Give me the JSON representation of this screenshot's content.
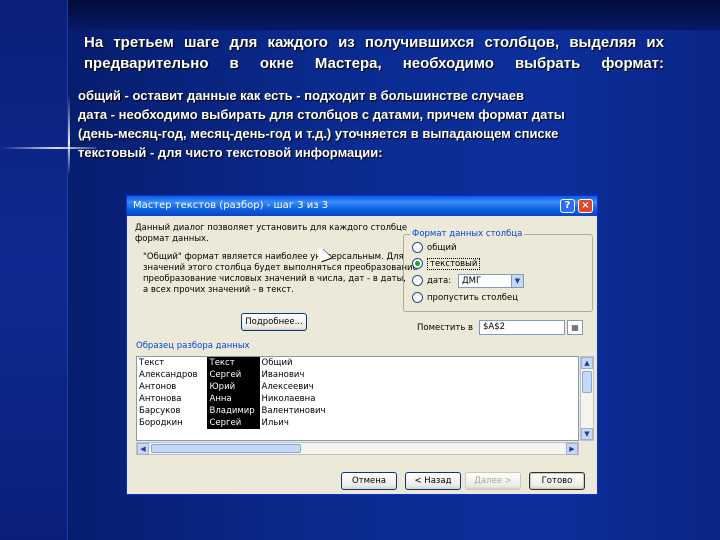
{
  "slide": {
    "heading_lines": [
      "На третьем шаге для каждого из получившихся столбцов, выделяя их",
      "предварительно в окне Мастера, необходимо выбрать формат:"
    ],
    "bullets": [
      "общий - оставит данные как есть - подходит в большинстве случаев",
      "дата - необходимо выбирать для столбцов с датами, причем формат даты",
      "(день-месяц-год, месяц-день-год и т.д.) уточняется в выпадающем списке",
      "текстовый - для чисто текстовой информации:"
    ]
  },
  "dialog": {
    "title": "Мастер текстов (разбор) - шаг 3 из 3",
    "help_glyph": "?",
    "close_glyph": "×",
    "description_lines": [
      "Данный диалог позволяет установить для каждого столбце",
      "формат данных."
    ],
    "note_lines": [
      "\"Общий\" формат является наиболее универсальным. Для",
      "значений этого столбца будет выполняться преобразование",
      "преобразование числовых значений в числа, дат - в даты,",
      "а всех прочих значений - в текст."
    ],
    "format_group": {
      "legend": "Формат данных столбца",
      "options": [
        {
          "label": "общий",
          "checked": false
        },
        {
          "label": "текстовый",
          "checked": true
        },
        {
          "label": "дата:",
          "checked": false
        },
        {
          "label": "пропустить столбец",
          "checked": false
        }
      ],
      "date_format": "ДМГ"
    },
    "details_button": "Подробнее...",
    "destination": {
      "label": "Поместить в",
      "value": "$A$2"
    },
    "preview": {
      "label": "Образец разбора данных",
      "headers": [
        "Текст",
        "Текст",
        "Общий"
      ],
      "rows": [
        [
          "Александров",
          "Сергей",
          "Иванович"
        ],
        [
          "Антонов",
          "Юрий",
          "Алексеевич"
        ],
        [
          "Антонова",
          "Анна",
          "Николаевна"
        ],
        [
          "Барсуков",
          "Владимир",
          "Валентинович"
        ],
        [
          "Бородкин",
          "Сергей",
          "Ильич"
        ]
      ]
    },
    "buttons": {
      "cancel": "Отмена",
      "back": "< Назад",
      "next": "Далее >",
      "finish": "Готово"
    }
  },
  "colors": {
    "slide_bg": "#0a2a8e",
    "dialog_face": "#ece9d8",
    "titlebar": "#0a58e6",
    "accent_text": "#0046d5"
  }
}
